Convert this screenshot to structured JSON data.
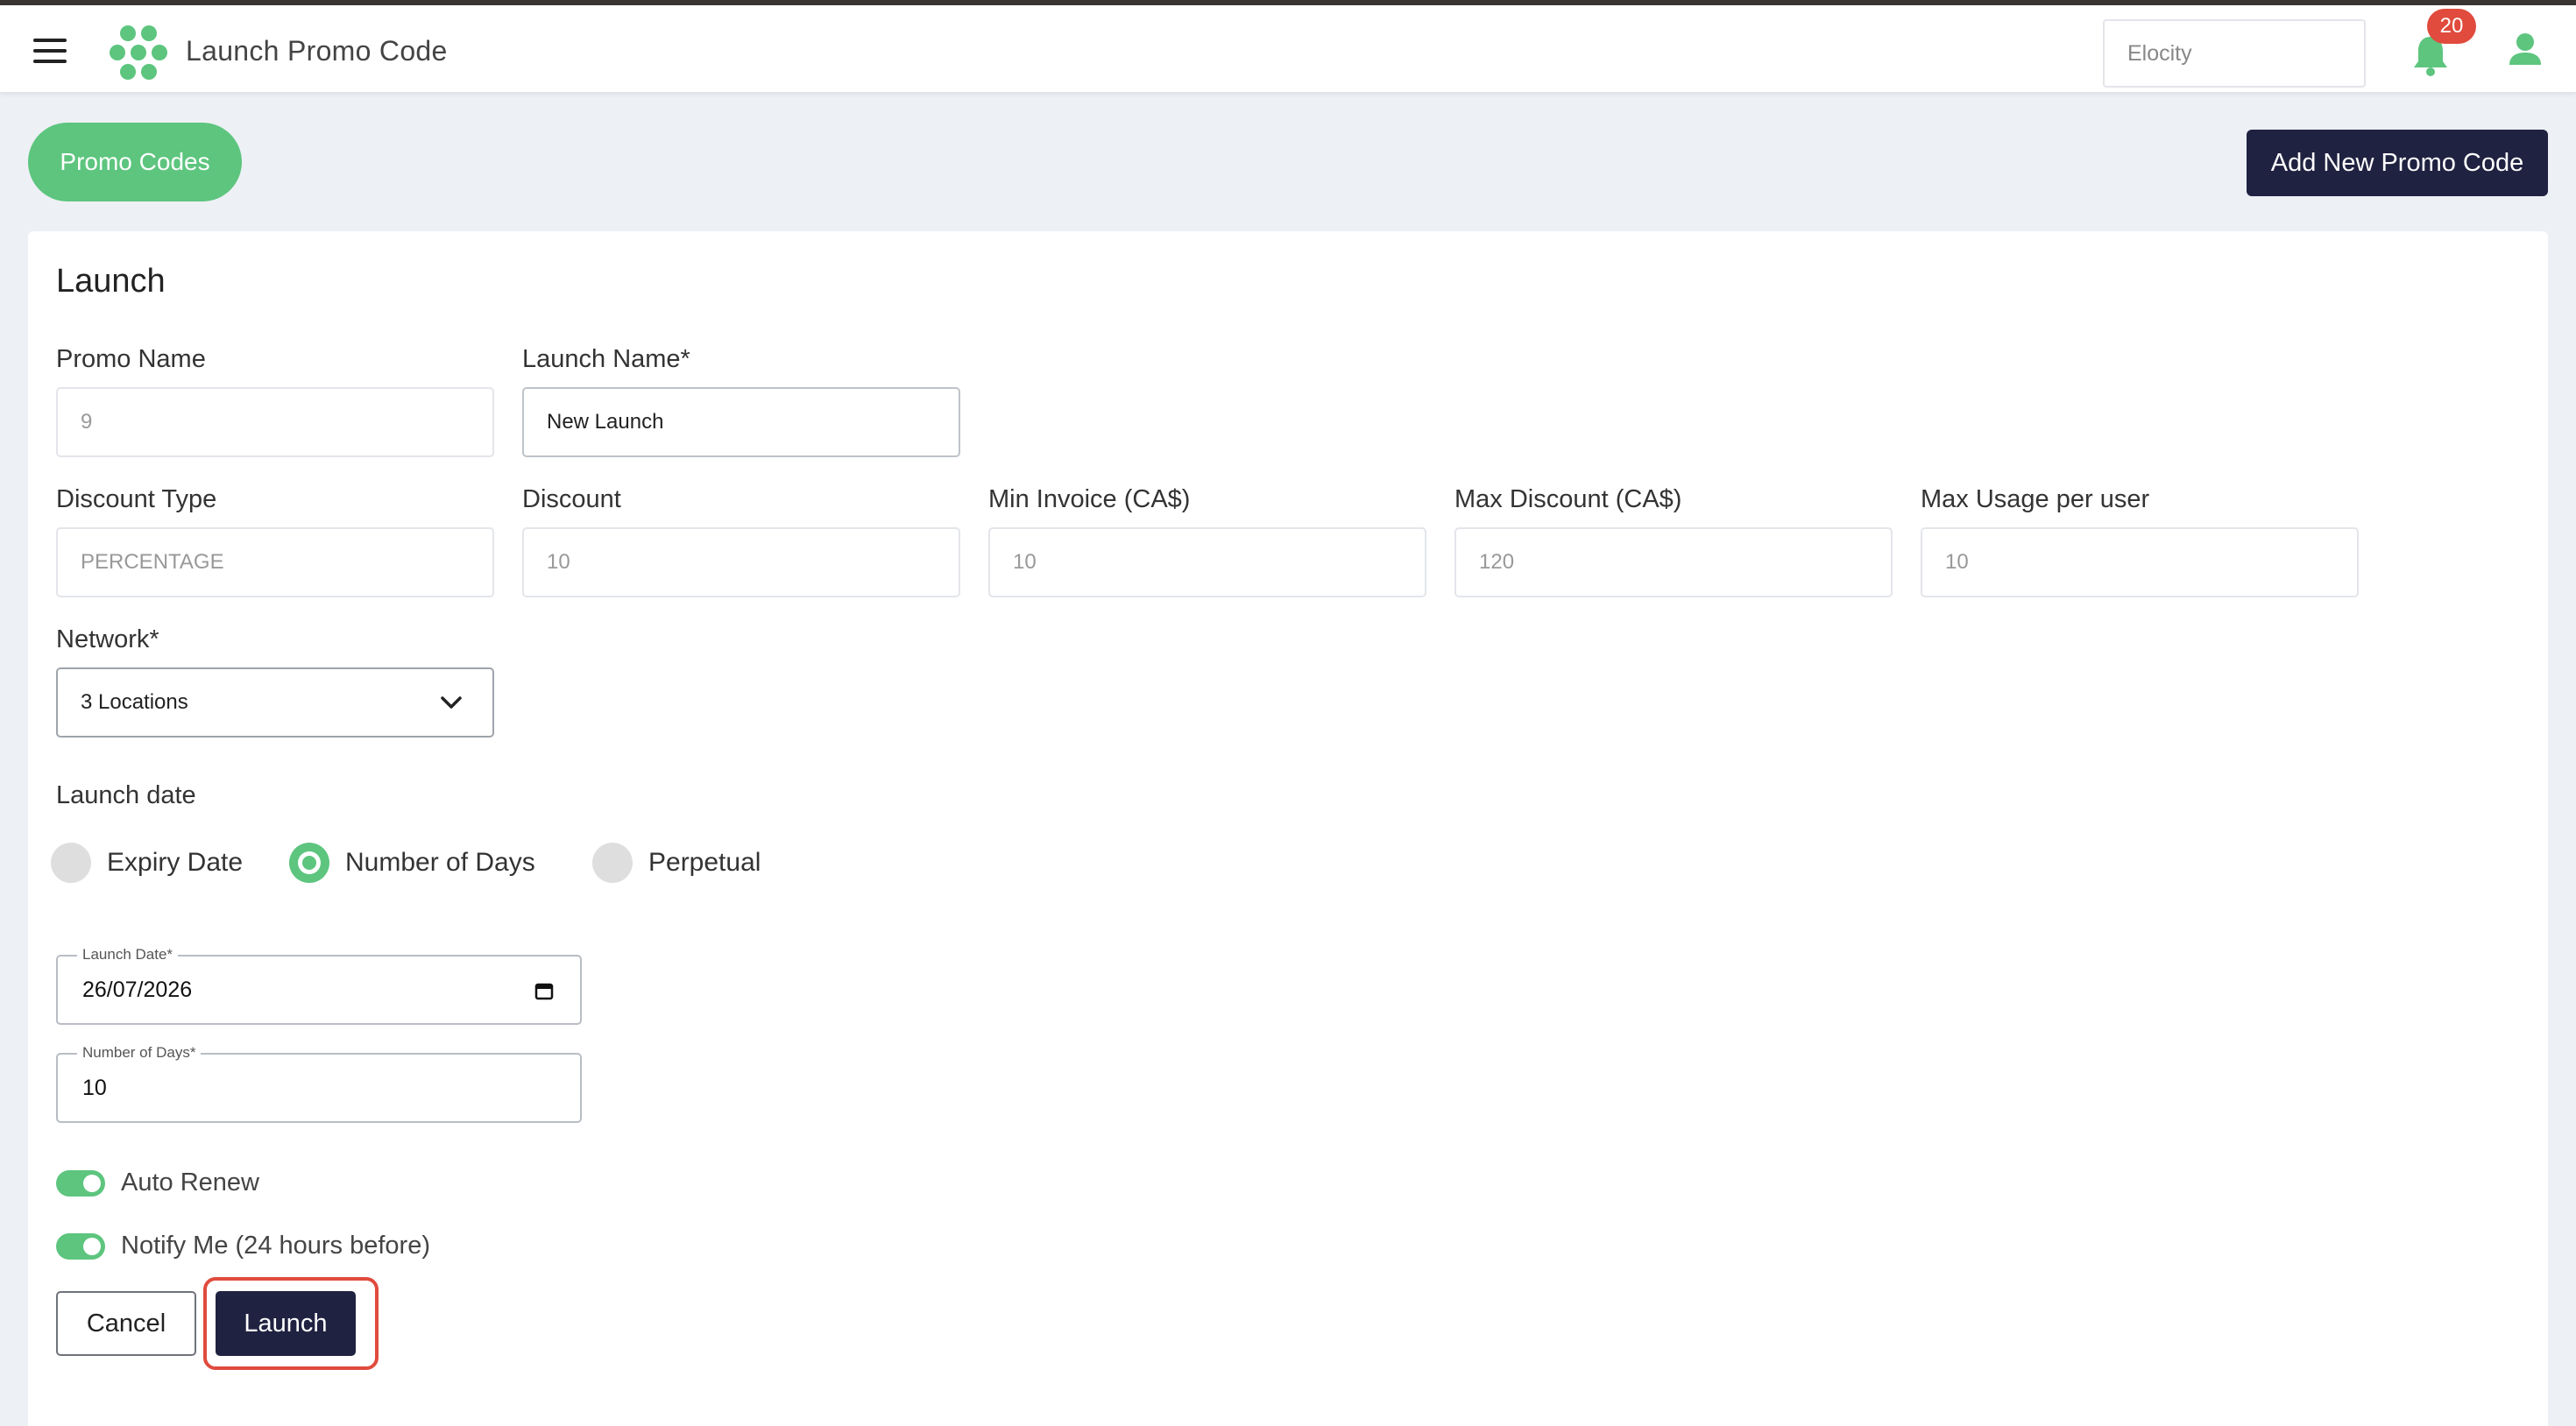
{
  "header": {
    "title": "Launch Promo Code",
    "org_value": "Elocity",
    "notification_count": "20"
  },
  "actions": {
    "promo_codes_label": "Promo Codes",
    "add_new_label": "Add New Promo Code"
  },
  "form": {
    "title": "Launch",
    "promo_name": {
      "label": "Promo Name",
      "value": "9"
    },
    "launch_name": {
      "label": "Launch Name*",
      "value": "New Launch"
    },
    "discount_type": {
      "label": "Discount Type",
      "value": "PERCENTAGE"
    },
    "discount": {
      "label": "Discount",
      "value": "10"
    },
    "min_invoice": {
      "label": "Min Invoice (CA$)",
      "value": "10"
    },
    "max_discount": {
      "label": "Max Discount (CA$)",
      "value": "120"
    },
    "max_usage": {
      "label": "Max Usage per user",
      "value": "10"
    },
    "network": {
      "label": "Network*",
      "value": "3 Locations"
    },
    "launch_date_section": "Launch date",
    "radio_options": [
      {
        "label": "Expiry Date",
        "selected": false
      },
      {
        "label": "Number of Days",
        "selected": true
      },
      {
        "label": "Perpetual",
        "selected": false
      }
    ],
    "launch_date": {
      "legend": "Launch Date*",
      "value": "26/07/2026"
    },
    "number_of_days": {
      "legend": "Number of Days*",
      "value": "10"
    },
    "auto_renew": {
      "label": "Auto Renew",
      "on": true
    },
    "notify_me": {
      "label": "Notify Me (24 hours before)",
      "on": true
    },
    "cancel_label": "Cancel",
    "launch_label": "Launch"
  },
  "colors": {
    "accent_green": "#5dc57e",
    "navy": "#1f2240",
    "badge_red": "#e04b3d",
    "highlight_red": "#e04b3d"
  }
}
